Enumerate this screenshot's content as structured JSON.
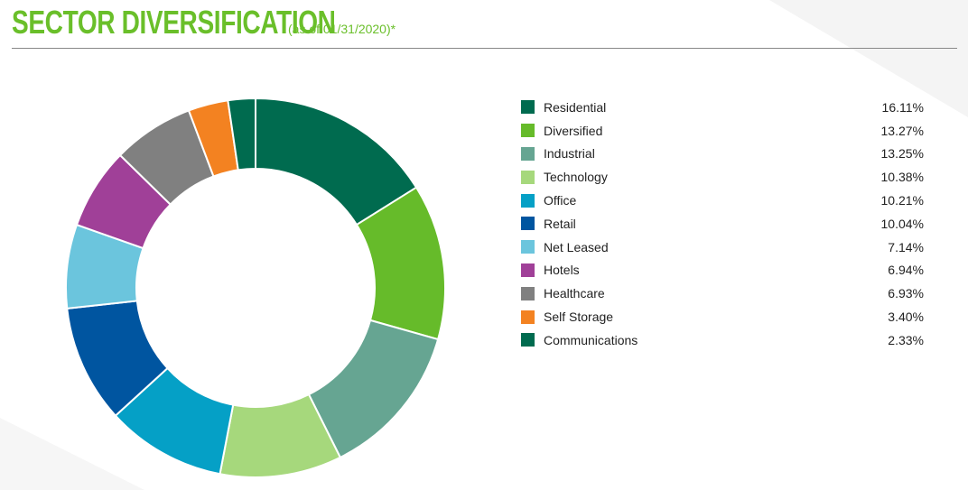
{
  "header": {
    "title": "SECTOR DIVERSIFICATION",
    "subtitle": "(as of 01/31/2020)*"
  },
  "chart_data": {
    "type": "pie",
    "donut": true,
    "title": "SECTOR DIVERSIFICATION",
    "subtitle": "(as of 01/31/2020)*",
    "legend_position": "right",
    "slices": [
      {
        "label": "Residential",
        "value": 16.11,
        "display": "16.11%",
        "color": "#006b4f"
      },
      {
        "label": "Diversified",
        "value": 13.27,
        "display": "13.27%",
        "color": "#66bb2a"
      },
      {
        "label": "Industrial",
        "value": 13.25,
        "display": "13.25%",
        "color": "#66a592"
      },
      {
        "label": "Technology",
        "value": 10.38,
        "display": "10.38%",
        "color": "#a6d87c"
      },
      {
        "label": "Office",
        "value": 10.21,
        "display": "10.21%",
        "color": "#05a0c6"
      },
      {
        "label": "Retail",
        "value": 10.04,
        "display": "10.04%",
        "color": "#0055a0"
      },
      {
        "label": "Net Leased",
        "value": 7.14,
        "display": "7.14%",
        "color": "#6bc5dd"
      },
      {
        "label": "Hotels",
        "value": 6.94,
        "display": "6.94%",
        "color": "#a04098"
      },
      {
        "label": "Healthcare",
        "value": 6.93,
        "display": "6.93%",
        "color": "#808080"
      },
      {
        "label": "Self Storage",
        "value": 3.4,
        "display": "3.40%",
        "color": "#f38221"
      },
      {
        "label": "Communications",
        "value": 2.33,
        "display": "2.33%",
        "color": "#006b4f"
      }
    ]
  }
}
